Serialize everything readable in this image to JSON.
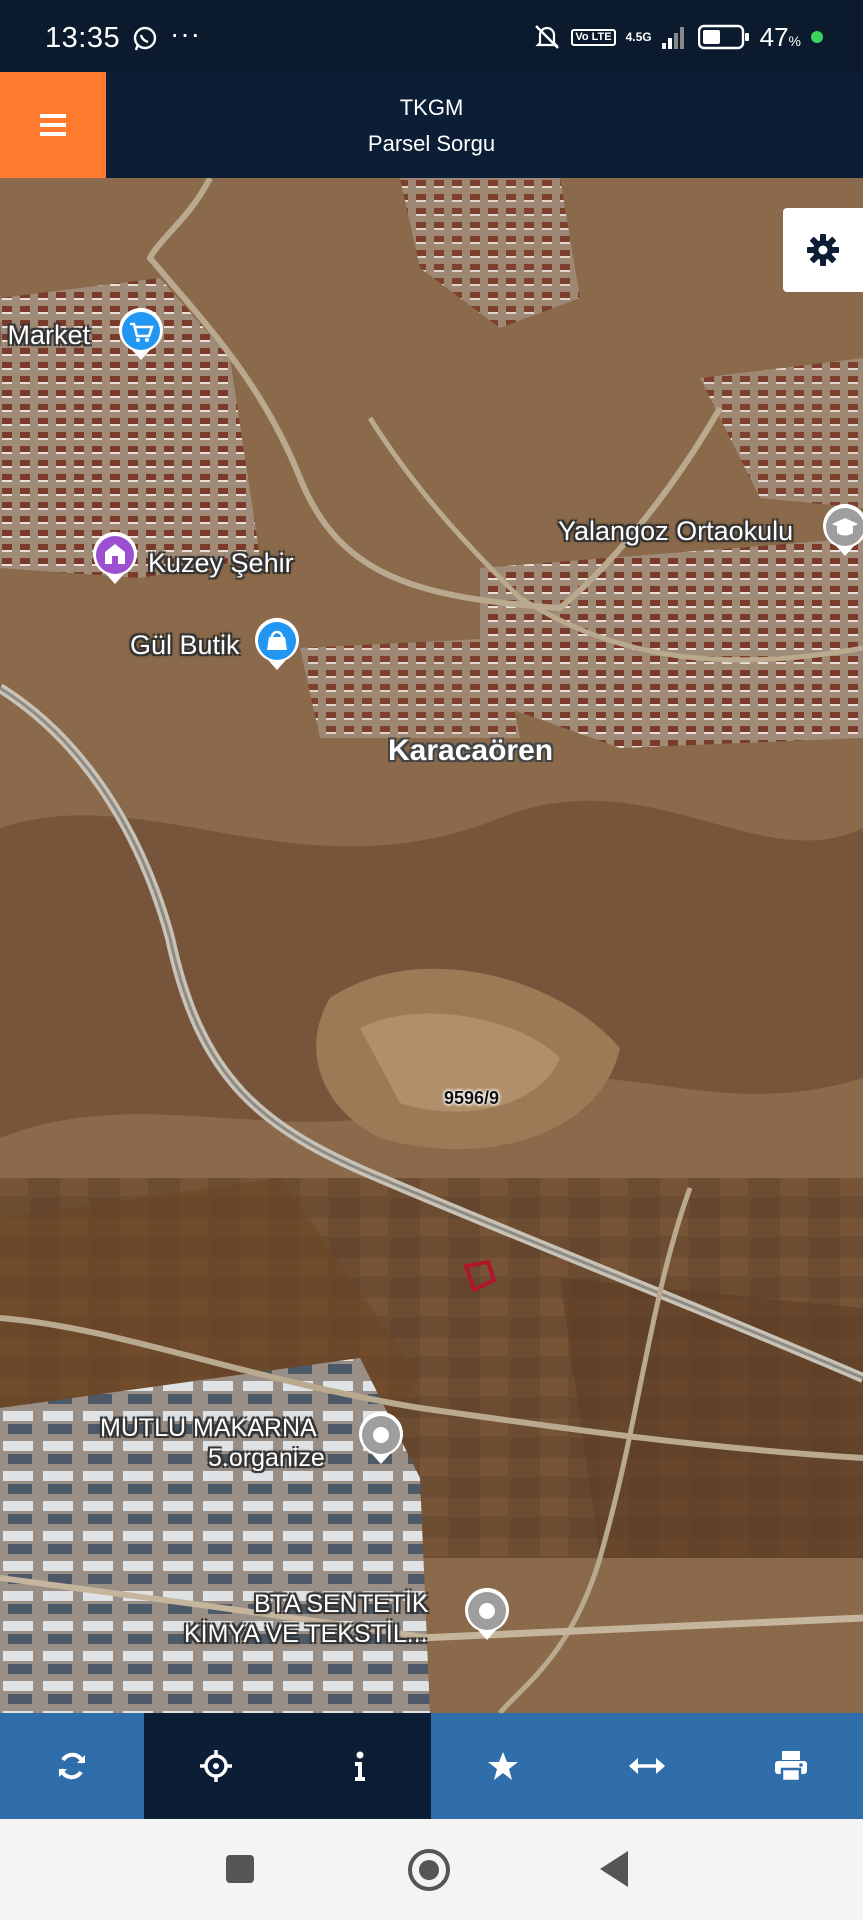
{
  "status_bar": {
    "time": "13:35",
    "dots": "···",
    "volte_label": "Vo LTE",
    "network": "4.5G",
    "battery_percent": "47",
    "battery_unit": "%"
  },
  "header": {
    "title": "TKGM",
    "subtitle": "Parsel Sorgu"
  },
  "map": {
    "pois": [
      {
        "label": "i Market",
        "icon": "shopping-cart-icon",
        "color": "#2196f3"
      },
      {
        "label": "Yalangoz Ortaokulu",
        "icon": "school-icon",
        "color": "#9e9e9e"
      },
      {
        "label": "Kuzey Şehir",
        "icon": "landmark-icon",
        "color": "#9c4fd1"
      },
      {
        "label": "Gül Butik",
        "icon": "shopping-bag-icon",
        "color": "#2196f3"
      },
      {
        "label": "MUTLU MAKARNA",
        "icon": "place-icon",
        "color": "#9e9e9e"
      },
      {
        "label": "5.organize",
        "icon": "",
        "color": ""
      },
      {
        "label": "BTA SENTETİK",
        "icon": "place-icon",
        "color": "#9e9e9e"
      },
      {
        "label": "KİMYA VE TEKSTİL...",
        "icon": "",
        "color": ""
      }
    ],
    "place_name": "Karacaören",
    "parcel_label": "9596/9",
    "parcel_color": "#b0162b"
  },
  "toolbar": {
    "items": [
      {
        "name": "refresh-icon"
      },
      {
        "name": "locate-icon"
      },
      {
        "name": "info-icon"
      },
      {
        "name": "star-icon"
      },
      {
        "name": "measure-icon"
      },
      {
        "name": "print-icon"
      }
    ]
  }
}
